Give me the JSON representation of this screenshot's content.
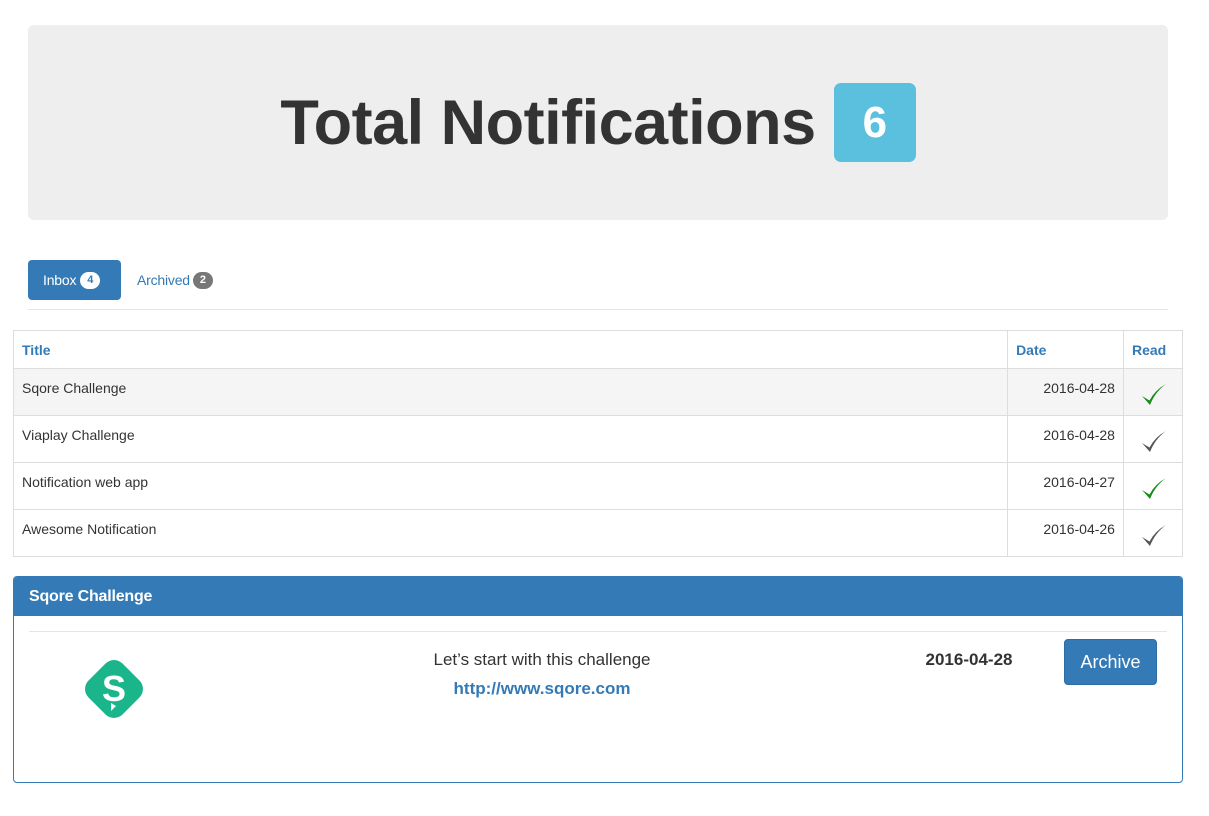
{
  "header": {
    "title": "Total Notifications",
    "total_count": "6"
  },
  "tabs": {
    "inbox": {
      "label": "Inbox",
      "count": "4"
    },
    "archived": {
      "label": "Archived",
      "count": "2"
    }
  },
  "table": {
    "columns": [
      "Title",
      "Date",
      "Read"
    ],
    "rows": [
      {
        "title": "Sqore Challenge",
        "date": "2016-04-28",
        "read_icon": "check-green-icon",
        "read": true
      },
      {
        "title": "Viaplay Challenge",
        "date": "2016-04-28",
        "read_icon": "check-gray-icon",
        "read": false
      },
      {
        "title": "Notification web app",
        "date": "2016-04-27",
        "read_icon": "check-green-icon",
        "read": true
      },
      {
        "title": "Awesome Notification",
        "date": "2016-04-26",
        "read_icon": "check-gray-icon",
        "read": false
      }
    ]
  },
  "detail": {
    "heading": "Sqore Challenge",
    "message": "Let’s start with this challenge",
    "link": "http://www.sqore.com",
    "date": "2016-04-28",
    "archive_label": "Archive",
    "logo_icon": "sqore-logo-icon"
  },
  "colors": {
    "primary": "#337ab7",
    "info_badge": "#5bc0de",
    "check_green": "#1a8a1a",
    "check_gray": "#555555",
    "logo_teal": "#1bb58b"
  }
}
